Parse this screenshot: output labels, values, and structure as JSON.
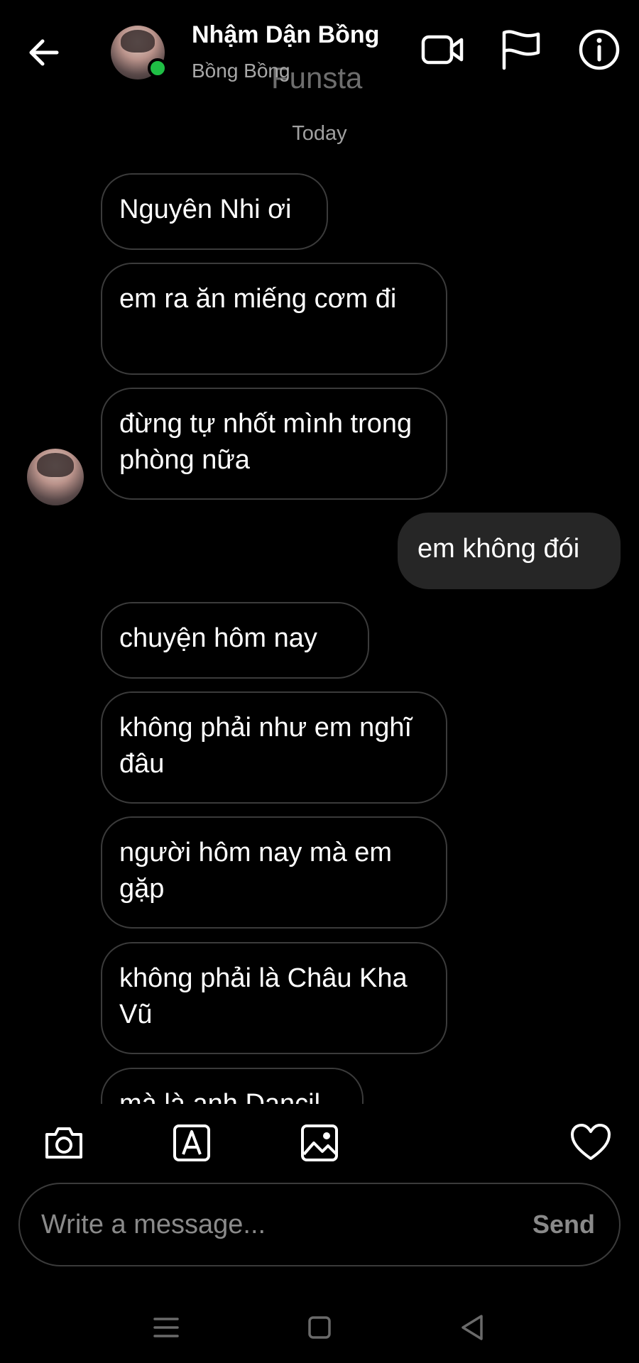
{
  "header": {
    "name": "Nhậm Dận Bồng",
    "subtitle": "Bồng Bồng",
    "overlay_text": "Funsta",
    "online_color": "#1fbf45",
    "icons": [
      "back-arrow-icon",
      "video-call-icon",
      "flag-icon",
      "info-icon"
    ]
  },
  "chat": {
    "date_label": "Today",
    "messages": [
      {
        "side": "in",
        "text": "Nguyên Nhi ơi"
      },
      {
        "side": "in",
        "text": "em ra ăn miếng cơm đi"
      },
      {
        "side": "in",
        "text": "đừng tự nhốt mình trong phòng nữa"
      },
      {
        "side": "out",
        "text": "em không đói"
      },
      {
        "side": "in",
        "text": "chuyện hôm nay"
      },
      {
        "side": "in",
        "text": "không phải như em nghĩ đâu"
      },
      {
        "side": "in",
        "text": "người hôm nay mà em gặp"
      },
      {
        "side": "in",
        "text": "không phải là Châu Kha Vũ"
      },
      {
        "side": "in",
        "text": "mà là anh Dancil"
      }
    ]
  },
  "composer": {
    "placeholder": "Write a message...",
    "send_label": "Send",
    "tools": [
      "camera-icon",
      "text-style-icon",
      "gallery-icon",
      "heart-icon"
    ]
  },
  "system_nav": [
    "menu-icon",
    "home-icon",
    "back-triangle-icon"
  ],
  "colors": {
    "background": "#000000",
    "incoming_border": "#3b3b3b",
    "outgoing_bubble": "#262626",
    "muted_text": "#a8a8a8"
  }
}
